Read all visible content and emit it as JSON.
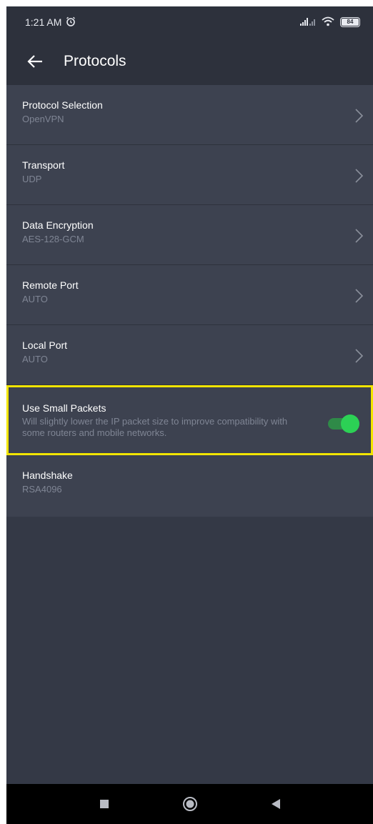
{
  "status_bar": {
    "time": "1:21 AM",
    "battery": "84"
  },
  "app_bar": {
    "title": "Protocols"
  },
  "rows": [
    {
      "title": "Protocol Selection",
      "value": "OpenVPN"
    },
    {
      "title": "Transport",
      "value": "UDP"
    },
    {
      "title": "Data Encryption",
      "value": "AES-128-GCM"
    },
    {
      "title": "Remote Port",
      "value": "AUTO"
    },
    {
      "title": "Local Port",
      "value": "AUTO"
    }
  ],
  "small_packets": {
    "title": "Use Small Packets",
    "description": "Will slightly lower the IP packet size to improve compatibility with some routers and mobile networks.",
    "enabled": true
  },
  "handshake": {
    "title": "Handshake",
    "value": "RSA4096"
  },
  "colors": {
    "background": "#343946",
    "row": "#3d4250",
    "highlight": "#f2e500",
    "toggle_on": "#2cd155"
  },
  "icons": {
    "back": "arrow-left-icon",
    "chevron": "chevron-right-icon",
    "alarm": "alarm-icon",
    "signal": "signal-icon",
    "wifi": "wifi-icon",
    "battery": "battery-icon",
    "nav_recents": "square-icon",
    "nav_home": "circle-icon",
    "nav_back": "triangle-back-icon"
  }
}
